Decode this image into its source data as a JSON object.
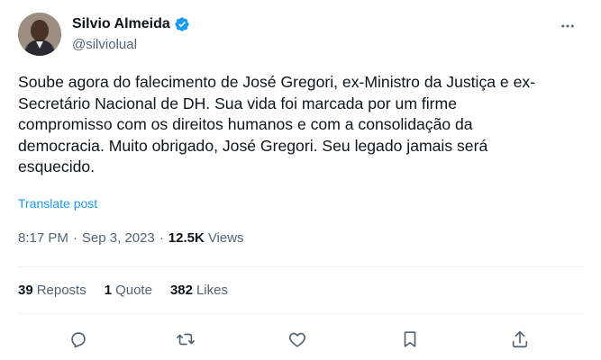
{
  "author": {
    "display_name": "Silvio Almeida",
    "handle": "@silviolual",
    "verified": true
  },
  "tweet": {
    "text": "Soube agora do falecimento de José Gregori, ex-Ministro da Justiça e ex-\nSecretário Nacional de DH. Sua vida foi marcada por um firme\ncompromisso com os direitos humanos e com a consolidação da\ndemocracia. Muito obrigado, José Gregori. Seu legado jamais será\nesquecido.",
    "translate_label": "Translate post"
  },
  "meta": {
    "time": "8:17 PM",
    "separator": "·",
    "date": "Sep 3, 2023",
    "views_count": "12.5K",
    "views_label": "Views"
  },
  "stats": {
    "reposts_count": "39",
    "reposts_label": "Reposts",
    "quotes_count": "1",
    "quotes_label": "Quote",
    "likes_count": "382",
    "likes_label": "Likes"
  },
  "icons": {
    "more": "more-dots-icon",
    "reply": "reply-icon",
    "repost": "repost-icon",
    "like": "like-icon",
    "bookmark": "bookmark-icon",
    "share": "share-icon",
    "verified": "verified-badge-icon"
  },
  "colors": {
    "text": "#0f1419",
    "secondary": "#536471",
    "link": "#1d9bf0",
    "divider": "#eff3f4"
  }
}
